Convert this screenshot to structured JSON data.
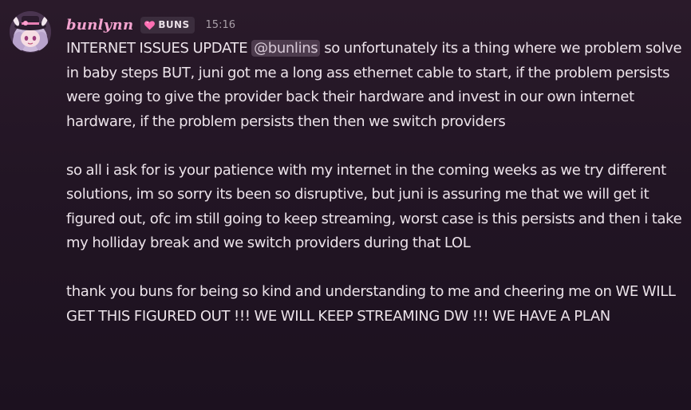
{
  "message": {
    "author": {
      "username": "bunlynn",
      "role_tag": "BUNS",
      "role_icon": "pink-heart-icon",
      "avatar_icon": "avatar-icon"
    },
    "timestamp": "15:16",
    "paragraph1_before_mention": "INTERNET ISSUES UPDATE ",
    "mention": "@bunlins",
    "paragraph1_after_mention": " so unfortunately its a thing where we problem solve in baby steps BUT, juni got me a long ass ethernet cable to start, if the problem persists were going to give the provider back their hardware and invest in our own internet hardware, if the problem persists then then we switch providers",
    "paragraph2": "so all i ask for is your patience with my internet in the coming weeks as we try different solutions, im so sorry its been so disruptive, but juni is assuring me that we will get it figured out, ofc im still going to keep streaming, worst case is this persists and then i take my holliday break and we switch providers during that LOL",
    "paragraph3": "thank you buns for being so kind and understanding to me and cheering me on WE WILL GET THIS FIGURED OUT !!! WE WILL KEEP STREAMING DW !!! WE HAVE A PLAN"
  },
  "colors": {
    "background": "#221524",
    "username": "#f3a3cf",
    "text": "#ece3ea",
    "mention_bg": "#5a4a5a",
    "role_bg": "#3b2d3d",
    "heart": "#ff6fb3"
  }
}
